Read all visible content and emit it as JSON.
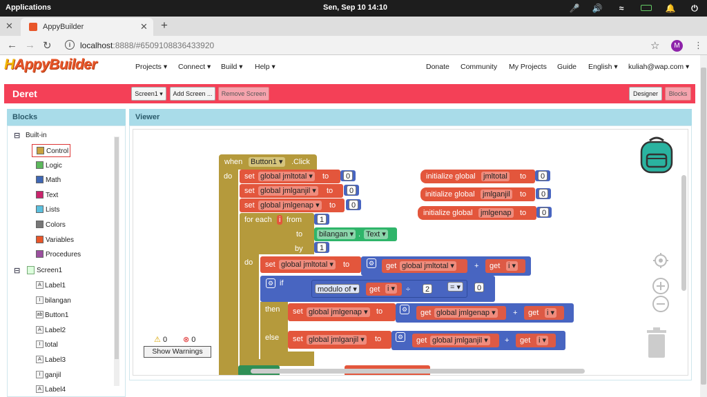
{
  "os": {
    "apps_label": "Applications",
    "datetime": "Sen, Sep 10   14:10"
  },
  "browser": {
    "tab_title": "AppyBuilder",
    "url_host": "localhost",
    "url_rest": ":8888/#6509108836433920",
    "avatar_letter": "M"
  },
  "app": {
    "logo": "AppyBuilder",
    "menus": [
      "Projects ▾",
      "Connect ▾",
      "Build ▾",
      "Help ▾"
    ],
    "right_links": [
      "Donate",
      "Community",
      "My Projects",
      "Guide",
      "English ▾",
      "kuliah@wap.com ▾"
    ],
    "project_name": "Deret",
    "screen_button": "Screen1 ▾",
    "add_screen": "Add Screen ...",
    "remove_screen": "Remove Screen",
    "designer": "Designer",
    "blocks_btn": "Blocks"
  },
  "blocks_panel": {
    "title": "Blocks",
    "builtin": "Built-in",
    "builtin_items": [
      {
        "label": "Control",
        "color": "#c9a23e"
      },
      {
        "label": "Logic",
        "color": "#5cb85c"
      },
      {
        "label": "Math",
        "color": "#3f67b4"
      },
      {
        "label": "Text",
        "color": "#c9246c"
      },
      {
        "label": "Lists",
        "color": "#5bc0de"
      },
      {
        "label": "Colors",
        "color": "#777777"
      },
      {
        "label": "Variables",
        "color": "#e8562a"
      },
      {
        "label": "Procedures",
        "color": "#9b4f9e"
      }
    ],
    "screen": "Screen1",
    "components": [
      {
        "label": "Label1",
        "icon": "A"
      },
      {
        "label": "bilangan",
        "icon": "I"
      },
      {
        "label": "Button1",
        "icon": "ab"
      },
      {
        "label": "Label2",
        "icon": "A"
      },
      {
        "label": "total",
        "icon": "I"
      },
      {
        "label": "Label3",
        "icon": "A"
      },
      {
        "label": "ganjil",
        "icon": "I"
      },
      {
        "label": "Label4",
        "icon": "A"
      }
    ]
  },
  "viewer": {
    "title": "Viewer",
    "warnings_count": "0",
    "errors_count": "0",
    "show_warnings": "Show Warnings",
    "event": {
      "when": "when",
      "component": "Button1 ▾",
      "event": ".Click",
      "do": "do"
    },
    "sets": [
      {
        "set": "set",
        "var": "global jmltotal ▾",
        "to": "to",
        "value": "0"
      },
      {
        "set": "set",
        "var": "global jmlganjil ▾",
        "to": "to",
        "value": "0"
      },
      {
        "set": "set",
        "var": "global jmlgenap ▾",
        "to": "to",
        "value": "0"
      }
    ],
    "for_each": {
      "label": "for each",
      "var": "i",
      "from": "from",
      "from_val": "1",
      "to": "to",
      "component": "bilangan ▾",
      "prop": "Text ▾",
      "by": "by",
      "by_val": "1",
      "do": "do"
    },
    "inner_set": {
      "set": "set",
      "var": "global jmltotal ▾",
      "to": "to",
      "get": "get",
      "get_var": "global jmltotal ▾",
      "plus": "+",
      "get2": "get",
      "get2_var": "i ▾"
    },
    "if_block": {
      "if": "if",
      "modulo": "modulo of ▾",
      "get": "get",
      "var": "i ▾",
      "div": "÷",
      "divisor": "2",
      "eq": "= ▾",
      "result": "0"
    },
    "then_set": {
      "then": "then",
      "set": "set",
      "var": "global jmlgenap ▾",
      "to": "to",
      "get": "get",
      "get_var": "global jmlgenap ▾",
      "plus": "+",
      "get2": "get",
      "get2_var": "i ▾"
    },
    "else_set": {
      "else": "else",
      "set": "set",
      "var": "global jmlganjil ▾",
      "to": "to",
      "get": "get",
      "get_var": "global jmlganjil ▾",
      "plus": "+",
      "get2": "get",
      "get2_var": "i ▾"
    },
    "inits": [
      {
        "label": "initialize global",
        "name": "jmltotal",
        "to": "to",
        "value": "0"
      },
      {
        "label": "initialize global",
        "name": "jmlganjil",
        "to": "to",
        "value": "0"
      },
      {
        "label": "initialize global",
        "name": "jmlgenap",
        "to": "to",
        "value": "0"
      }
    ]
  }
}
